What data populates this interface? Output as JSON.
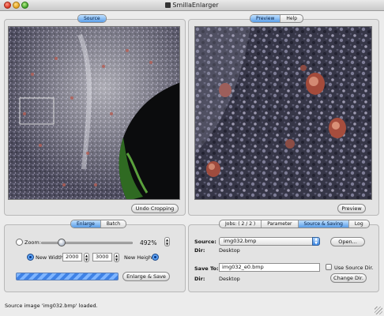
{
  "window": {
    "title": "SmillaEnlarger"
  },
  "source_panel": {
    "tab_label": "Source",
    "undo_button": "Undo Cropping"
  },
  "preview_panel": {
    "tabs": [
      {
        "label": "Preview",
        "selected": true
      },
      {
        "label": "Help",
        "selected": false
      }
    ],
    "preview_button": "Preview"
  },
  "enlarge_panel": {
    "tabs": [
      {
        "label": "Enlarge",
        "selected": true
      },
      {
        "label": "Batch",
        "selected": false
      }
    ],
    "zoom_label": "Zoom:",
    "zoom_value": "492%",
    "zoom_slider_fraction": 0.22,
    "new_width_label": "New Width:",
    "new_width_value": "2000",
    "new_height_value": "3000",
    "new_height_label": "New Height",
    "enlarge_button": "Enlarge & Save"
  },
  "jobs_panel": {
    "tabs": [
      {
        "label": "Jobs: ( 2 / 2 )",
        "selected": false
      },
      {
        "label": "Parameter",
        "selected": false
      },
      {
        "label": "Source & Saving",
        "selected": true
      },
      {
        "label": "Log",
        "selected": false
      }
    ],
    "source_label": "Source:",
    "source_value": "img032.bmp",
    "source_dir_label": "Dir:",
    "source_dir_value": "Desktop",
    "open_button": "Open...",
    "save_to_label": "Save To:",
    "save_to_value": "img032_e0.bmp",
    "use_source_dir_label": "Use Source Dir.",
    "save_dir_label": "Dir:",
    "save_dir_value": "Desktop",
    "change_dir_button": "Change Dir."
  },
  "status_bar": {
    "text": "Source image 'img032.bmp' loaded."
  },
  "colors": {
    "accent": "#3f82e5"
  }
}
